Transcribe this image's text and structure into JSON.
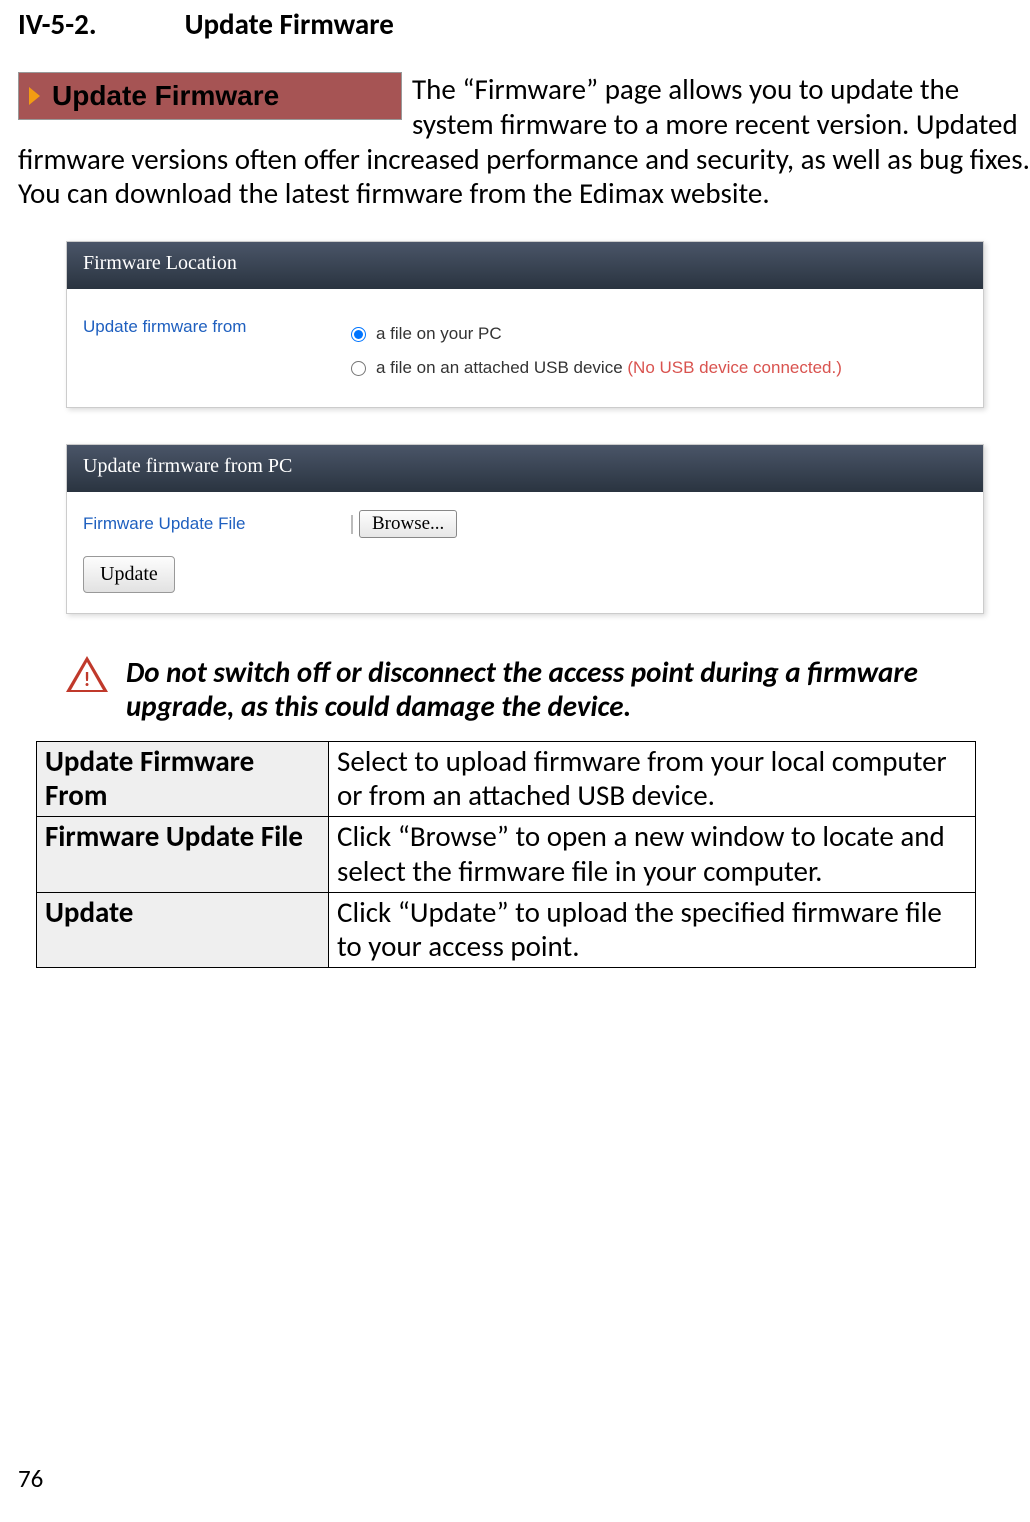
{
  "section": {
    "number": "IV-5-2.",
    "title": "Update Firmware"
  },
  "banner": {
    "label": "Update Firmware"
  },
  "intro": "The “Firmware” page allows you to update the system firmware to a more recent version. Updated firmware versions often offer increased performance and security, as well as bug fixes. You can download the latest firmware from the Edimax website.",
  "panel1": {
    "header": "Firmware Location",
    "row_label": "Update firmware from",
    "options": [
      {
        "label": "a file on your PC",
        "checked": true,
        "warn": ""
      },
      {
        "label": "a file on an attached USB device ",
        "checked": false,
        "warn": "(No USB device connected.)"
      }
    ]
  },
  "panel2": {
    "header": "Update firmware from PC",
    "row_label": "Firmware Update File",
    "browse_label": "Browse...",
    "update_label": "Update"
  },
  "callout": "Do not switch off or disconnect the access point during a firmware upgrade, as this could damage the device.",
  "table": [
    {
      "key": "Update Firmware From",
      "val": "Select to upload firmware from your local computer or from an attached USB device."
    },
    {
      "key": "Firmware Update File",
      "val": "Click “Browse” to open a new window to locate and select the firmware file in your computer."
    },
    {
      "key": "Update",
      "val": "Click “Update” to upload the specified firmware file to your access point."
    }
  ],
  "page_number": "76"
}
